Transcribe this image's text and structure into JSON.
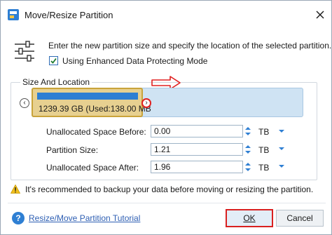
{
  "window": {
    "title": "Move/Resize Partition"
  },
  "intro": {
    "text": "Enter the new partition size and specify the location of the selected partition.",
    "checkbox_label": "Using Enhanced Data Protecting Mode",
    "checkbox_checked": true
  },
  "size_location": {
    "group_title": "Size And Location",
    "partition_label": "1239.39 GB (Used:138.00 MB",
    "fields": [
      {
        "label": "Unallocated Space Before:",
        "value": "0.00",
        "unit": "TB"
      },
      {
        "label": "Partition Size:",
        "value": "1.21",
        "unit": "TB"
      },
      {
        "label": "Unallocated Space After:",
        "value": "1.96",
        "unit": "TB"
      }
    ]
  },
  "warning": {
    "text": "It's recommended to backup your data before moving or resizing the partition."
  },
  "footer": {
    "help_link": "Resize/Move Partition Tutorial",
    "ok_label": "OK",
    "cancel_label": "Cancel"
  },
  "colors": {
    "accent": "#2e7fd3",
    "highlight_red": "#d92020",
    "partition_fill": "#e7d090",
    "disk_area": "#cfe3f3"
  },
  "icons": {
    "app": "partition-app-icon",
    "close": "close-icon",
    "settings": "sliders-icon",
    "warning": "warning-icon",
    "help": "help-icon"
  }
}
